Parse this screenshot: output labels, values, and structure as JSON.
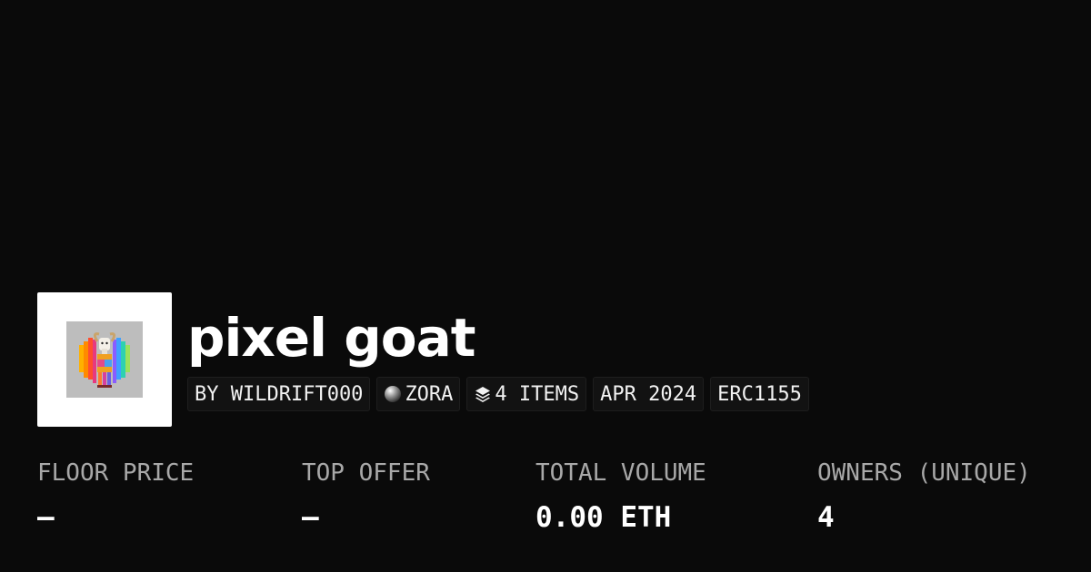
{
  "collection": {
    "title": "pixel goat",
    "thumbnail_alt": "goat"
  },
  "chips": [
    {
      "label": "BY WILDRIFT000",
      "icon": ""
    },
    {
      "label": "ZORA",
      "icon": "zora-orb-icon"
    },
    {
      "label": "4 ITEMS",
      "icon": "layers-icon"
    },
    {
      "label": "APR 2024",
      "icon": ""
    },
    {
      "label": "ERC1155",
      "icon": ""
    }
  ],
  "stats": [
    {
      "label": "FLOOR PRICE",
      "value": "–"
    },
    {
      "label": "TOP OFFER",
      "value": "–"
    },
    {
      "label": "TOTAL VOLUME",
      "value": "0.00 ETH"
    },
    {
      "label": "OWNERS (UNIQUE)",
      "value": "4"
    }
  ],
  "colors": {
    "background": "#0a0a0a",
    "chip_background": "#121212",
    "label_gray": "#a8a8a8",
    "text": "#ffffff"
  }
}
